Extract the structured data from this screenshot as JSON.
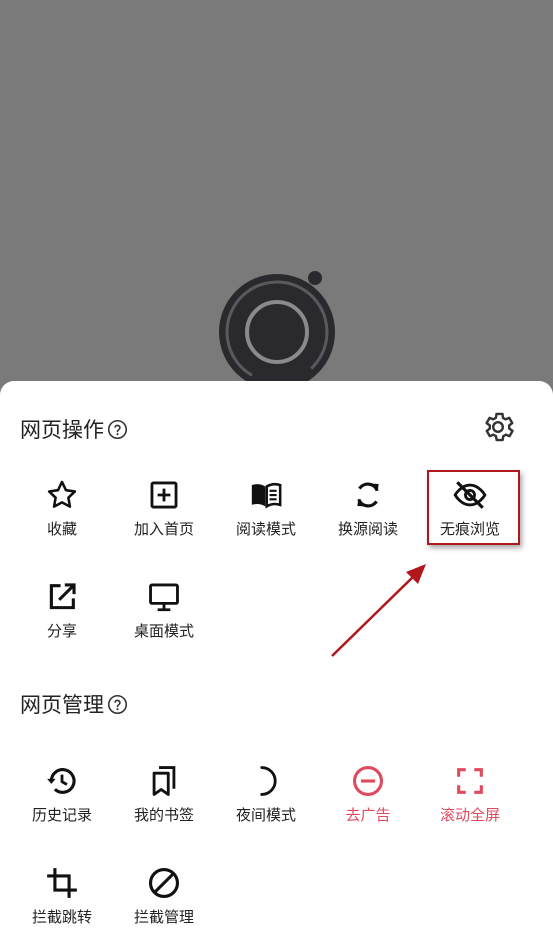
{
  "sections": {
    "web_ops": {
      "title": "网页操作",
      "items": [
        {
          "label": "收藏",
          "icon": "star-icon"
        },
        {
          "label": "加入首页",
          "icon": "add-box-icon"
        },
        {
          "label": "阅读模式",
          "icon": "book-icon"
        },
        {
          "label": "换源阅读",
          "icon": "refresh-icon"
        },
        {
          "label": "无痕浏览",
          "icon": "eye-off-icon"
        },
        {
          "label": "分享",
          "icon": "share-icon"
        },
        {
          "label": "桌面模式",
          "icon": "monitor-icon"
        }
      ]
    },
    "web_manage": {
      "title": "网页管理",
      "items": [
        {
          "label": "历史记录",
          "icon": "history-icon"
        },
        {
          "label": "我的书签",
          "icon": "bookmarks-icon"
        },
        {
          "label": "夜间模式",
          "icon": "moon-icon"
        },
        {
          "label": "去广告",
          "icon": "minus-circle-icon"
        },
        {
          "label": "滚动全屏",
          "icon": "fullscreen-icon"
        },
        {
          "label": "拦截跳转",
          "icon": "crop-icon"
        },
        {
          "label": "拦截管理",
          "icon": "block-icon"
        }
      ]
    }
  },
  "colors": {
    "accent_red": "#e04a5f",
    "highlight_border": "#b0161c",
    "overlay": "#7a7a7a"
  }
}
